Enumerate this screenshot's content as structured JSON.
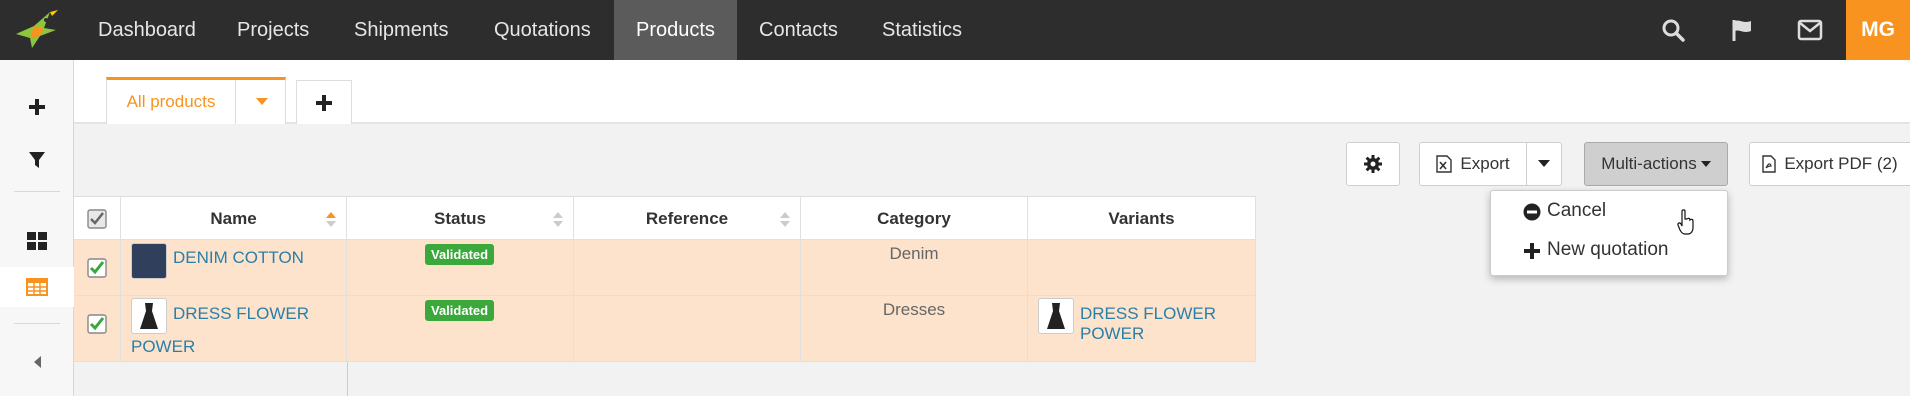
{
  "nav": {
    "items": [
      "Dashboard",
      "Projects",
      "Shipments",
      "Quotations",
      "Products",
      "Contacts",
      "Statistics"
    ],
    "active": "Products",
    "icons": [
      "search-icon",
      "flag-icon",
      "envelope-icon"
    ],
    "avatar_initials": "MG"
  },
  "sidebar": {
    "icons": [
      "plus-icon",
      "filter-icon",
      "grid-view-icon",
      "table-view-icon",
      "collapse-left-icon"
    ],
    "active": "table-view-icon"
  },
  "tabs": {
    "active_label": "All products"
  },
  "toolbar": {
    "export_label": "Export",
    "multi_actions_label": "Multi-actions",
    "export_pdf_label": "Export PDF (2)"
  },
  "multi_actions_menu": {
    "items": [
      {
        "icon": "minus-circle-icon",
        "label": "Cancel"
      },
      {
        "icon": "plus-icon",
        "label": "New quotation"
      }
    ]
  },
  "table": {
    "columns": [
      "Name",
      "Status",
      "Reference",
      "Category",
      "Variants"
    ],
    "rows": [
      {
        "selected": true,
        "name_line1": "DENIM COTTON",
        "name_line2": "",
        "status": "Validated",
        "reference": "",
        "category": "Denim",
        "variant": ""
      },
      {
        "selected": true,
        "name_line1": "DRESS FLOWER",
        "name_line2": "POWER",
        "status": "Validated",
        "reference": "",
        "category": "Dresses",
        "variant": "DRESS FLOWER POWER"
      }
    ]
  },
  "colors": {
    "brand_orange": "#f7931e",
    "topbar": "#2d2d2d",
    "selected_row": "#fde3cc",
    "badge_green": "#3aa83a",
    "link_blue": "#2a7fa8",
    "checkbox_green": "#3aa83a"
  }
}
